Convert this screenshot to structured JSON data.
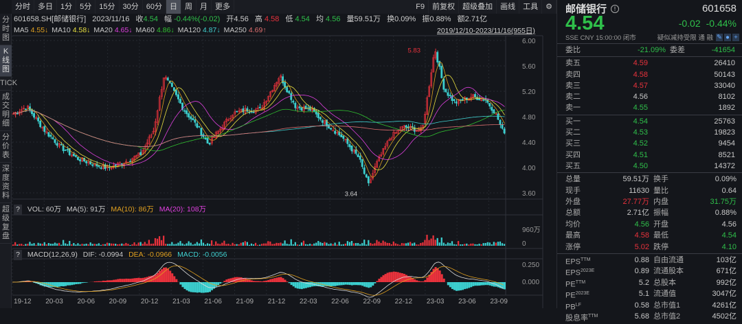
{
  "toolbar": {
    "periods": [
      "分时",
      "多日",
      "1分",
      "5分",
      "15分",
      "30分",
      "60分",
      "日",
      "周",
      "月",
      "更多"
    ],
    "active": "日",
    "right": [
      "F9",
      "前复权",
      "超级叠加",
      "画线",
      "工具"
    ]
  },
  "side_tabs": [
    "分时图",
    "K线图",
    "TICK",
    "成交明细",
    "分价表",
    "深度资料",
    "超级复盘"
  ],
  "info": {
    "code": "601658.SH[邮储银行]",
    "date": "2023/11/16",
    "close_l": "收",
    "close": "4.54",
    "chg_l": "幅",
    "chg": "-0.44%(-0.02)",
    "open_l": "开",
    "open": "4.56",
    "high_l": "高",
    "high": "4.58",
    "low_l": "低",
    "low": "4.54",
    "avg_l": "均",
    "avg": "4.56",
    "vol": "量59.51万",
    "turn": "换0.09%",
    "amp": "振0.88%",
    "amt": "额2.71亿"
  },
  "ma": [
    {
      "l": "MA5",
      "v": "4.55↓",
      "c": "#e0a020"
    },
    {
      "l": "MA10",
      "v": "4.58↓",
      "c": "#e8e040"
    },
    {
      "l": "MA20",
      "v": "4.65↓",
      "c": "#e040e0"
    },
    {
      "l": "MA60",
      "v": "4.86↓",
      "c": "#30c030"
    },
    {
      "l": "MA120",
      "v": "4.87↓",
      "c": "#40d0d0"
    },
    {
      "l": "MA250",
      "v": "4.69↑",
      "c": "#e07070"
    }
  ],
  "range": "2019/12/10-2023/11/16(955日)",
  "vol_hdr": {
    "vol": "VOL: 60万",
    "ma5": "MA(5): 91万",
    "ma10": "MA(10): 86万",
    "ma20": "MA(20): 108万",
    "q": "?"
  },
  "macd_hdr": {
    "name": "MACD(12,26,9)",
    "dif": "DIF: -0.0994",
    "dea": "DEA: -0.0966",
    "macd": "MACD: -0.0056",
    "q": "?"
  },
  "colors": {
    "up": "#e8323c",
    "down": "#3ccfcf",
    "green": "#2fbf4a"
  },
  "chart_data": {
    "type": "candlestick",
    "ylim": [
      3.5,
      6.05
    ],
    "yticks": [
      "6.00",
      "5.60",
      "5.20",
      "4.80",
      "4.40",
      "4.00",
      "3.60"
    ],
    "annotations": [
      {
        "text": "5.83",
        "price": 5.83,
        "month": 39.3
      },
      {
        "text": "3.64",
        "price": 3.64,
        "month": 33.6
      }
    ],
    "xticks": [
      "19-12",
      "20-03",
      "20-06",
      "20-09",
      "20-12",
      "21-03",
      "21-06",
      "21-09",
      "21-12",
      "22-03",
      "22-06",
      "22-09",
      "22-12",
      "23-03",
      "23-06",
      "23-09"
    ],
    "keypoints_month": [
      0,
      1.3,
      3,
      4.6,
      6,
      7.8,
      9,
      10.7,
      12.1,
      13.3,
      14.3,
      15.1,
      16.2,
      17.5,
      18.5,
      19.5,
      20.8,
      22.1,
      23.4,
      25.3,
      26.8,
      28.2,
      29.7,
      31.2,
      32.8,
      33.7,
      34.4,
      35.8,
      37,
      38.8,
      39.7,
      40,
      40.9,
      41.9,
      43.5,
      44.8,
      45.8,
      46.5
    ],
    "keypoints_close": [
      4.85,
      4.96,
      4.58,
      4.31,
      4.15,
      4.04,
      3.99,
      4.1,
      4.21,
      4.58,
      5.45,
      5.23,
      4.91,
      4.64,
      4.37,
      4.58,
      4.85,
      4.91,
      4.91,
      5.45,
      4.96,
      4.91,
      4.69,
      4.48,
      4.15,
      3.72,
      4.04,
      4.48,
      4.64,
      4.58,
      5.56,
      5.88,
      5.23,
      5.02,
      5.12,
      5.07,
      4.85,
      4.54
    ],
    "volume_axis": [
      "960万",
      "0"
    ],
    "macd_axis": [
      "0.250",
      "0.000"
    ]
  },
  "quote": {
    "name": "邮储银行",
    "code": "601658",
    "price": "4.54",
    "chg": "-0.02",
    "pct": "-0.44%",
    "meta": "SSE  CNY  15:00:00  闭市",
    "flags": "疑似减持受限  通  融"
  },
  "weibi": {
    "l": "委比",
    "v": "-21.09%",
    "l2": "委差",
    "v2": "-41654"
  },
  "asks": [
    {
      "l": "卖五",
      "p": "4.59",
      "q": "26410",
      "c": "r"
    },
    {
      "l": "卖四",
      "p": "4.58",
      "q": "50143",
      "c": "r"
    },
    {
      "l": "卖三",
      "p": "4.57",
      "q": "33040",
      "c": "r"
    },
    {
      "l": "卖二",
      "p": "4.56",
      "q": "8102",
      "c": "w"
    },
    {
      "l": "卖一",
      "p": "4.55",
      "q": "1892",
      "c": "g"
    }
  ],
  "bids": [
    {
      "l": "买一",
      "p": "4.54",
      "q": "25763",
      "c": "g"
    },
    {
      "l": "买二",
      "p": "4.53",
      "q": "19823",
      "c": "g"
    },
    {
      "l": "买三",
      "p": "4.52",
      "q": "9454",
      "c": "g"
    },
    {
      "l": "买四",
      "p": "4.51",
      "q": "8521",
      "c": "g"
    },
    {
      "l": "买五",
      "p": "4.50",
      "q": "14372",
      "c": "g"
    }
  ],
  "stats": [
    {
      "a": "总量",
      "b": "59.51万",
      "bc": "w",
      "c": "换手",
      "d": "0.09%",
      "dc": "w"
    },
    {
      "a": "现手",
      "b": "11630",
      "bc": "w",
      "c": "量比",
      "d": "0.64",
      "dc": "w"
    },
    {
      "a": "外盘",
      "b": "27.77万",
      "bc": "r",
      "c": "内盘",
      "d": "31.75万",
      "dc": "g"
    },
    {
      "a": "总额",
      "b": "2.71亿",
      "bc": "w",
      "c": "振幅",
      "d": "0.88%",
      "dc": "w"
    },
    {
      "a": "均价",
      "b": "4.56",
      "bc": "g",
      "c": "开盘",
      "d": "4.56",
      "dc": "w"
    },
    {
      "a": "最高",
      "b": "4.58",
      "bc": "r",
      "c": "最低",
      "d": "4.54",
      "dc": "g"
    },
    {
      "a": "涨停",
      "b": "5.02",
      "bc": "r",
      "c": "跌停",
      "d": "4.10",
      "dc": "g"
    }
  ],
  "fund": [
    {
      "a": "EPS",
      "s": "TTM",
      "b": "0.88",
      "c": "自由流通",
      "d": "103亿"
    },
    {
      "a": "EPS",
      "s": "2023E",
      "b": "0.89",
      "c": "流通股本",
      "d": "671亿"
    },
    {
      "a": "PE",
      "s": "TTM",
      "b": "5.2",
      "c": "总股本",
      "d": "992亿"
    },
    {
      "a": "PE",
      "s": "2023E",
      "b": "5.1",
      "c": "流通值",
      "d": "3047亿"
    },
    {
      "a": "PB",
      "s": "LF",
      "b": "0.58",
      "c": "总市值1",
      "d": "4261亿"
    },
    {
      "a": "股息率",
      "s": "TTM",
      "b": "5.68",
      "c": "总市值2",
      "d": "4502亿"
    }
  ]
}
